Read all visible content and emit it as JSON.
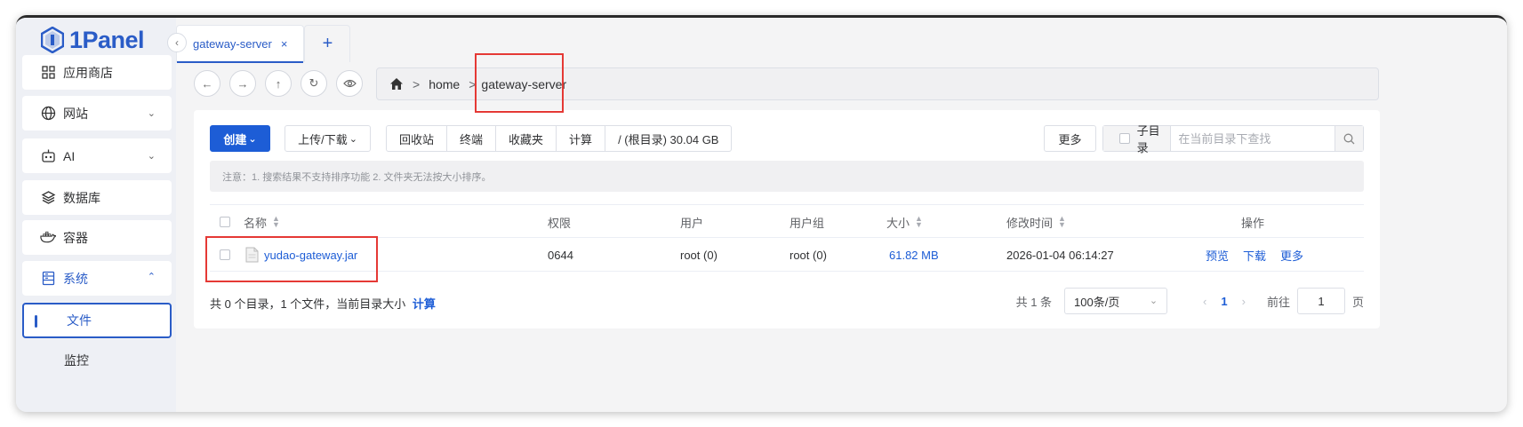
{
  "app": {
    "logo_text": "1Panel"
  },
  "sidebar": {
    "items": [
      {
        "label": "应用商店",
        "icon": "grid-icon"
      },
      {
        "label": "网站",
        "icon": "globe-icon"
      },
      {
        "label": "AI",
        "icon": "robot-icon"
      },
      {
        "label": "数据库",
        "icon": "layers-icon"
      },
      {
        "label": "容器",
        "icon": "docker-icon"
      },
      {
        "label": "系统",
        "icon": "server-icon"
      }
    ],
    "sub_items": [
      {
        "label": "文件"
      },
      {
        "label": "监控"
      }
    ]
  },
  "tabs": [
    {
      "label": "gateway-server",
      "close": "×"
    }
  ],
  "tab_add": "+",
  "breadcrumb": {
    "parts": [
      "home",
      "gateway-server"
    ],
    "separator": ">"
  },
  "toolbar": {
    "create": "创建",
    "upload_download": "上传/下载",
    "recycle": "回收站",
    "terminal": "终端",
    "favorites": "收藏夹",
    "calculate": "计算",
    "disk": "/ (根目录) 30.04 GB",
    "more": "更多",
    "subdir": "子目录",
    "search_placeholder": "在当前目录下查找"
  },
  "notice": "注意：1. 搜索结果不支持排序功能 2. 文件夹无法按大小排序。",
  "table": {
    "headers": {
      "name": "名称",
      "perm": "权限",
      "user": "用户",
      "group": "用户组",
      "size": "大小",
      "mtime": "修改时间",
      "ops": "操作"
    },
    "rows": [
      {
        "name": "yudao-gateway.jar",
        "perm": "0644",
        "user": "root (0)",
        "group": "root (0)",
        "size": "61.82 MB",
        "mtime": "2026-01-04 06:14:27",
        "op_preview": "预览",
        "op_download": "下载",
        "op_more": "更多"
      }
    ]
  },
  "footer": {
    "summary": "共 0 个目录，1 个文件，当前目录大小",
    "calc_link": "计算",
    "total": "共 1 条",
    "page_size": "100条/页",
    "current_page": "1",
    "goto_label": "前往",
    "goto_value": "1",
    "page_suffix": "页"
  },
  "colors": {
    "accent": "#1d5dd6",
    "highlight": "#e53935"
  }
}
